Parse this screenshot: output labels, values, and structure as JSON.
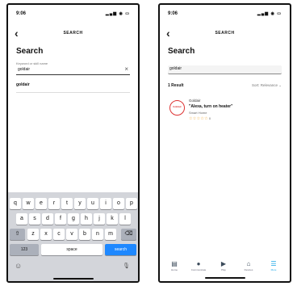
{
  "left_screen": {
    "status": {
      "time": "9:06",
      "indicators": "▂▄▆ ◉ ▭"
    },
    "nav": {
      "back": "‹",
      "title": "SEARCH"
    },
    "heading": "Search",
    "field_label": "Keyword or skill name",
    "input_value": "goldair",
    "clear": "×",
    "suggestion": "goldair",
    "keyboard": {
      "row1": [
        "q",
        "w",
        "e",
        "r",
        "t",
        "y",
        "u",
        "i",
        "o",
        "p"
      ],
      "row2": [
        "a",
        "s",
        "d",
        "f",
        "g",
        "h",
        "j",
        "k",
        "l"
      ],
      "row3": [
        "z",
        "x",
        "c",
        "v",
        "b",
        "n",
        "m"
      ],
      "shift": "⇧",
      "backspace": "⌫",
      "numbers": "123",
      "space": "space",
      "search": "search",
      "emoji": "☺",
      "mic": "🎙"
    }
  },
  "right_screen": {
    "status": {
      "time": "9:06",
      "indicators": "▂▄▆ ◉ ▭"
    },
    "nav": {
      "back": "‹",
      "title": "SEARCH"
    },
    "heading": "Search",
    "input_value": "goldair",
    "result_count": "1 Result",
    "sort": "Sort: Relevance ⌄",
    "result": {
      "logo_text": "Goldair",
      "name": "Goldair",
      "phrase": "\"Alexa, turn on heater\"",
      "category": "Smart Home",
      "stars": "☆☆☆☆☆",
      "rating_count": "0"
    },
    "tabs": [
      {
        "icon": "home-icon",
        "glyph": "▤",
        "label": "Home"
      },
      {
        "icon": "communicate-icon",
        "glyph": "●",
        "label": "Communicate"
      },
      {
        "icon": "play-icon",
        "glyph": "▶",
        "label": "Play"
      },
      {
        "icon": "devices-icon",
        "glyph": "⌂",
        "label": "Devices"
      },
      {
        "icon": "more-icon",
        "glyph": "☰",
        "label": "More"
      }
    ]
  }
}
